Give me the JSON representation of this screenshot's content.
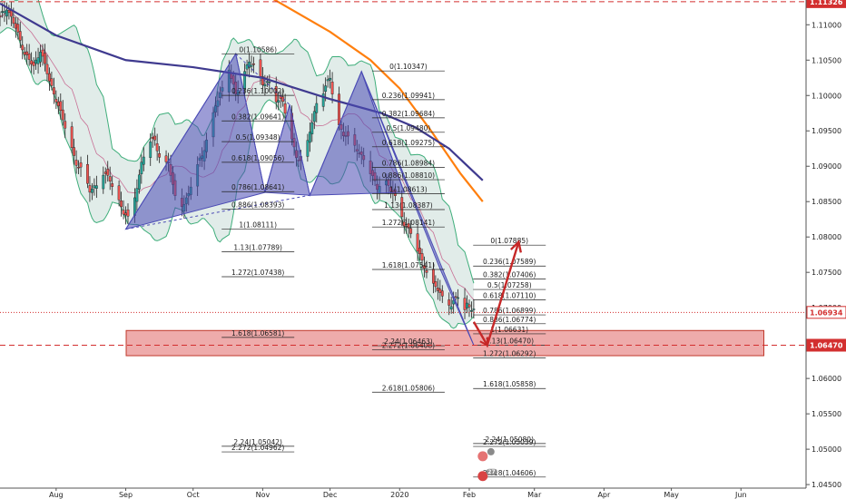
{
  "chart_data": {
    "type": "candlestick",
    "title": "",
    "ylim": [
      1.0445,
      1.1135
    ],
    "y_ticks": [
      "1.11000",
      "1.10500",
      "1.10000",
      "1.09500",
      "1.09000",
      "1.08500",
      "1.08000",
      "1.07500",
      "1.07000",
      "1.06500",
      "1.06000",
      "1.05500",
      "1.05000",
      "1.04500"
    ],
    "x_ticks": [
      {
        "label": "Aug",
        "day": 0
      },
      {
        "label": "Sep",
        "day": 31
      },
      {
        "label": "Oct",
        "day": 61
      },
      {
        "label": "Nov",
        "day": 92
      },
      {
        "label": "Dec",
        "day": 122
      },
      {
        "label": "2020",
        "day": 153
      },
      {
        "label": "Feb",
        "day": 184
      },
      {
        "label": "Mar",
        "day": 213
      },
      {
        "label": "Apr",
        "day": 244
      },
      {
        "label": "May",
        "day": 274
      },
      {
        "label": "Jun",
        "day": 305
      }
    ],
    "xlim": [
      -25,
      334
    ],
    "price_tags": [
      {
        "value": "1.11326",
        "y": 1.11326,
        "line": "dashed",
        "color": "#d32f2f"
      },
      {
        "value": "1.06934",
        "y": 1.06934,
        "line": "dotted",
        "color": "#d32f2f"
      },
      {
        "value": "1.06470",
        "y": 1.0647,
        "line": "dashed",
        "color": "#d32f2f"
      }
    ],
    "close_series": [
      {
        "day": -25,
        "close": 1.111
      },
      {
        "day": -22,
        "close": 1.1125
      },
      {
        "day": -18,
        "close": 1.1095
      },
      {
        "day": -14,
        "close": 1.106
      },
      {
        "day": -10,
        "close": 1.104
      },
      {
        "day": -7,
        "close": 1.1065
      },
      {
        "day": -3,
        "close": 1.102
      },
      {
        "day": 0,
        "close": 1.0995
      },
      {
        "day": 3,
        "close": 1.0965
      },
      {
        "day": 6,
        "close": 1.0935
      },
      {
        "day": 9,
        "close": 1.0905
      },
      {
        "day": 12,
        "close": 1.089
      },
      {
        "day": 15,
        "close": 1.0865
      },
      {
        "day": 18,
        "close": 1.0875
      },
      {
        "day": 21,
        "close": 1.089
      },
      {
        "day": 24,
        "close": 1.088
      },
      {
        "day": 27,
        "close": 1.086
      },
      {
        "day": 30,
        "close": 1.0835
      },
      {
        "day": 32,
        "close": 1.0825
      },
      {
        "day": 35,
        "close": 1.0855
      },
      {
        "day": 38,
        "close": 1.0905
      },
      {
        "day": 41,
        "close": 1.0935
      },
      {
        "day": 44,
        "close": 1.0935
      },
      {
        "day": 47,
        "close": 1.0905
      },
      {
        "day": 50,
        "close": 1.0905
      },
      {
        "day": 53,
        "close": 1.0855
      },
      {
        "day": 56,
        "close": 1.0845
      },
      {
        "day": 59,
        "close": 1.086
      },
      {
        "day": 62,
        "close": 1.0895
      },
      {
        "day": 65,
        "close": 1.0915
      },
      {
        "day": 68,
        "close": 1.095
      },
      {
        "day": 71,
        "close": 1.0985
      },
      {
        "day": 74,
        "close": 1.101
      },
      {
        "day": 77,
        "close": 1.104
      },
      {
        "day": 80,
        "close": 1.1
      },
      {
        "day": 83,
        "close": 1.1025
      },
      {
        "day": 86,
        "close": 1.105
      },
      {
        "day": 89,
        "close": 1.104
      },
      {
        "day": 92,
        "close": 1.1015
      },
      {
        "day": 95,
        "close": 1.102
      },
      {
        "day": 98,
        "close": 1.0995
      },
      {
        "day": 101,
        "close": 1.099
      },
      {
        "day": 104,
        "close": 1.095
      },
      {
        "day": 107,
        "close": 1.0915
      },
      {
        "day": 110,
        "close": 1.09
      },
      {
        "day": 113,
        "close": 1.095
      },
      {
        "day": 116,
        "close": 1.099
      },
      {
        "day": 119,
        "close": 1.1005
      },
      {
        "day": 122,
        "close": 1.1025
      },
      {
        "day": 125,
        "close": 1.0965
      },
      {
        "day": 128,
        "close": 1.0945
      },
      {
        "day": 131,
        "close": 1.0935
      },
      {
        "day": 134,
        "close": 1.0925
      },
      {
        "day": 137,
        "close": 1.091
      },
      {
        "day": 140,
        "close": 1.089
      },
      {
        "day": 143,
        "close": 1.087
      },
      {
        "day": 146,
        "close": 1.0885
      },
      {
        "day": 149,
        "close": 1.0865
      },
      {
        "day": 152,
        "close": 1.085
      },
      {
        "day": 155,
        "close": 1.082
      },
      {
        "day": 158,
        "close": 1.0805
      },
      {
        "day": 161,
        "close": 1.078
      },
      {
        "day": 164,
        "close": 1.076
      },
      {
        "day": 167,
        "close": 1.0735
      },
      {
        "day": 170,
        "close": 1.0725
      },
      {
        "day": 173,
        "close": 1.071
      },
      {
        "day": 176,
        "close": 1.0705
      },
      {
        "day": 179,
        "close": 1.0715
      },
      {
        "day": 181,
        "close": 1.069
      },
      {
        "day": 183,
        "close": 1.0705
      },
      {
        "day": 185,
        "close": 1.07
      },
      {
        "day": 188,
        "close": 1.0693
      }
    ],
    "overlays": [
      {
        "name": "",
        "color": "#ff7f0e",
        "points": [
          {
            "day": 61,
            "value": 1.12
          },
          {
            "day": 92,
            "value": 1.1145
          },
          {
            "day": 122,
            "value": 1.109
          },
          {
            "day": 140,
            "value": 1.105
          },
          {
            "day": 153,
            "value": 1.101
          },
          {
            "day": 167,
            "value": 1.095
          },
          {
            "day": 180,
            "value": 1.089
          },
          {
            "day": 190,
            "value": 1.085
          }
        ]
      },
      {
        "name": "",
        "color": "#3f3a8f",
        "points": [
          {
            "day": -25,
            "value": 1.113
          },
          {
            "day": 0,
            "value": 1.1085
          },
          {
            "day": 31,
            "value": 1.105
          },
          {
            "day": 61,
            "value": 1.104
          },
          {
            "day": 92,
            "value": 1.1025
          },
          {
            "day": 122,
            "value": 1.0995
          },
          {
            "day": 145,
            "value": 1.0975
          },
          {
            "day": 160,
            "value": 1.0955
          },
          {
            "day": 175,
            "value": 1.0925
          },
          {
            "day": 190,
            "value": 1.088
          }
        ]
      }
    ],
    "harmonic_patterns": [
      {
        "points": [
          {
            "day": 31,
            "value": 1.0811
          },
          {
            "day": 80,
            "value": 1.1059
          },
          {
            "day": 93,
            "value": 1.0863
          },
          {
            "day": 104,
            "value": 1.0987
          },
          {
            "day": 113,
            "value": 1.0859
          },
          {
            "day": 136,
            "value": 1.1034
          },
          {
            "day": 155,
            "value": 1.0863
          }
        ]
      },
      {
        "points": [
          {
            "day": 136,
            "value": 1.1034
          },
          {
            "day": 186,
            "value": 1.0647
          }
        ]
      }
    ],
    "fib_labels": [
      {
        "text": "0(1.10586)",
        "day": 81,
        "y": 1.10586
      },
      {
        "text": "0.236(1.10002)",
        "day": 81,
        "y": 1.10002
      },
      {
        "text": "0.382(1.09641)",
        "day": 81,
        "y": 1.09641
      },
      {
        "text": "0.5(1.09348)",
        "day": 81,
        "y": 1.09348
      },
      {
        "text": "0.618(1.09056)",
        "day": 81,
        "y": 1.09056
      },
      {
        "text": "0.786(1.08641)",
        "day": 81,
        "y": 1.08641
      },
      {
        "text": "0.886(1.08393)",
        "day": 81,
        "y": 1.08393
      },
      {
        "text": "1(1.08111)",
        "day": 81,
        "y": 1.08111
      },
      {
        "text": "1.13(1.07789)",
        "day": 81,
        "y": 1.07789
      },
      {
        "text": "1.272(1.07438)",
        "day": 81,
        "y": 1.07438
      },
      {
        "text": "1.618(1.06581)",
        "day": 81,
        "y": 1.06581
      },
      {
        "text": "0(1.10347)",
        "day": 148,
        "y": 1.10347
      },
      {
        "text": "0.236(1.09941)",
        "day": 148,
        "y": 1.09941
      },
      {
        "text": "0.382(1.09684)",
        "day": 148,
        "y": 1.09684
      },
      {
        "text": "0.5(1.09480)",
        "day": 148,
        "y": 1.0948
      },
      {
        "text": "0.618(1.09275)",
        "day": 148,
        "y": 1.09275
      },
      {
        "text": "0.786(1.08984)",
        "day": 148,
        "y": 1.08984
      },
      {
        "text": "0.886(1.08810)",
        "day": 148,
        "y": 1.0881
      },
      {
        "text": "1(1.08613)",
        "day": 148,
        "y": 1.08613
      },
      {
        "text": "1.13(1.08387)",
        "day": 148,
        "y": 1.08387
      },
      {
        "text": "1.272(1.08141)",
        "day": 148,
        "y": 1.08141
      },
      {
        "text": "1.618(1.07541)",
        "day": 148,
        "y": 1.07541
      },
      {
        "text": "2.24(1.06463)",
        "day": 148,
        "y": 1.06463
      },
      {
        "text": "2.272(1.06408)",
        "day": 148,
        "y": 1.06408
      },
      {
        "text": "2.618(1.05806)",
        "day": 148,
        "y": 1.05806
      },
      {
        "text": "2.24(1.05042)",
        "day": 81,
        "y": 1.05042
      },
      {
        "text": "2.272(1.04962)",
        "day": 81,
        "y": 1.04962
      },
      {
        "text": "0(1.07885)",
        "day": 193,
        "y": 1.07885
      },
      {
        "text": "0.236(1.07589)",
        "day": 193,
        "y": 1.07589
      },
      {
        "text": "0.382(1.07406)",
        "day": 193,
        "y": 1.07406
      },
      {
        "text": "0.5(1.07258)",
        "day": 193,
        "y": 1.07258
      },
      {
        "text": "0.618(1.07110)",
        "day": 193,
        "y": 1.0711
      },
      {
        "text": "0.786(1.06899)",
        "day": 193,
        "y": 1.06899
      },
      {
        "text": "0.886(1.06774)",
        "day": 193,
        "y": 1.06774
      },
      {
        "text": "1(1.06631)",
        "day": 193,
        "y": 1.06631
      },
      {
        "text": "1.13(1.06470)",
        "day": 193,
        "y": 1.0647
      },
      {
        "text": "1.272(1.06292)",
        "day": 193,
        "y": 1.06292
      },
      {
        "text": "1.618(1.05858)",
        "day": 193,
        "y": 1.05858
      },
      {
        "text": "2.24(1.05080)",
        "day": 193,
        "y": 1.0508
      },
      {
        "text": "2.272(1.05039)",
        "day": 193,
        "y": 1.05039
      },
      {
        "text": "2.618(1.04606)",
        "day": 193,
        "y": 1.04606
      }
    ],
    "zone": {
      "from_day": 31,
      "to_day": 315,
      "top": 1.06678,
      "bottom": 1.06322,
      "color": "#e06666"
    },
    "projection": {
      "color": "#c62828",
      "points": [
        {
          "day": 186,
          "value": 1.068
        },
        {
          "day": 192,
          "value": 1.0647
        },
        {
          "day": 206,
          "value": 1.0793
        }
      ]
    },
    "badges": [
      {
        "text": "4"
      },
      {
        "text": "27"
      }
    ],
    "grid": true
  },
  "colors": {
    "up": "#26a69a",
    "down": "#ef5350",
    "bands": "#3fae7b",
    "pattern": "#4b4bb5",
    "red": "#d32f2f"
  }
}
